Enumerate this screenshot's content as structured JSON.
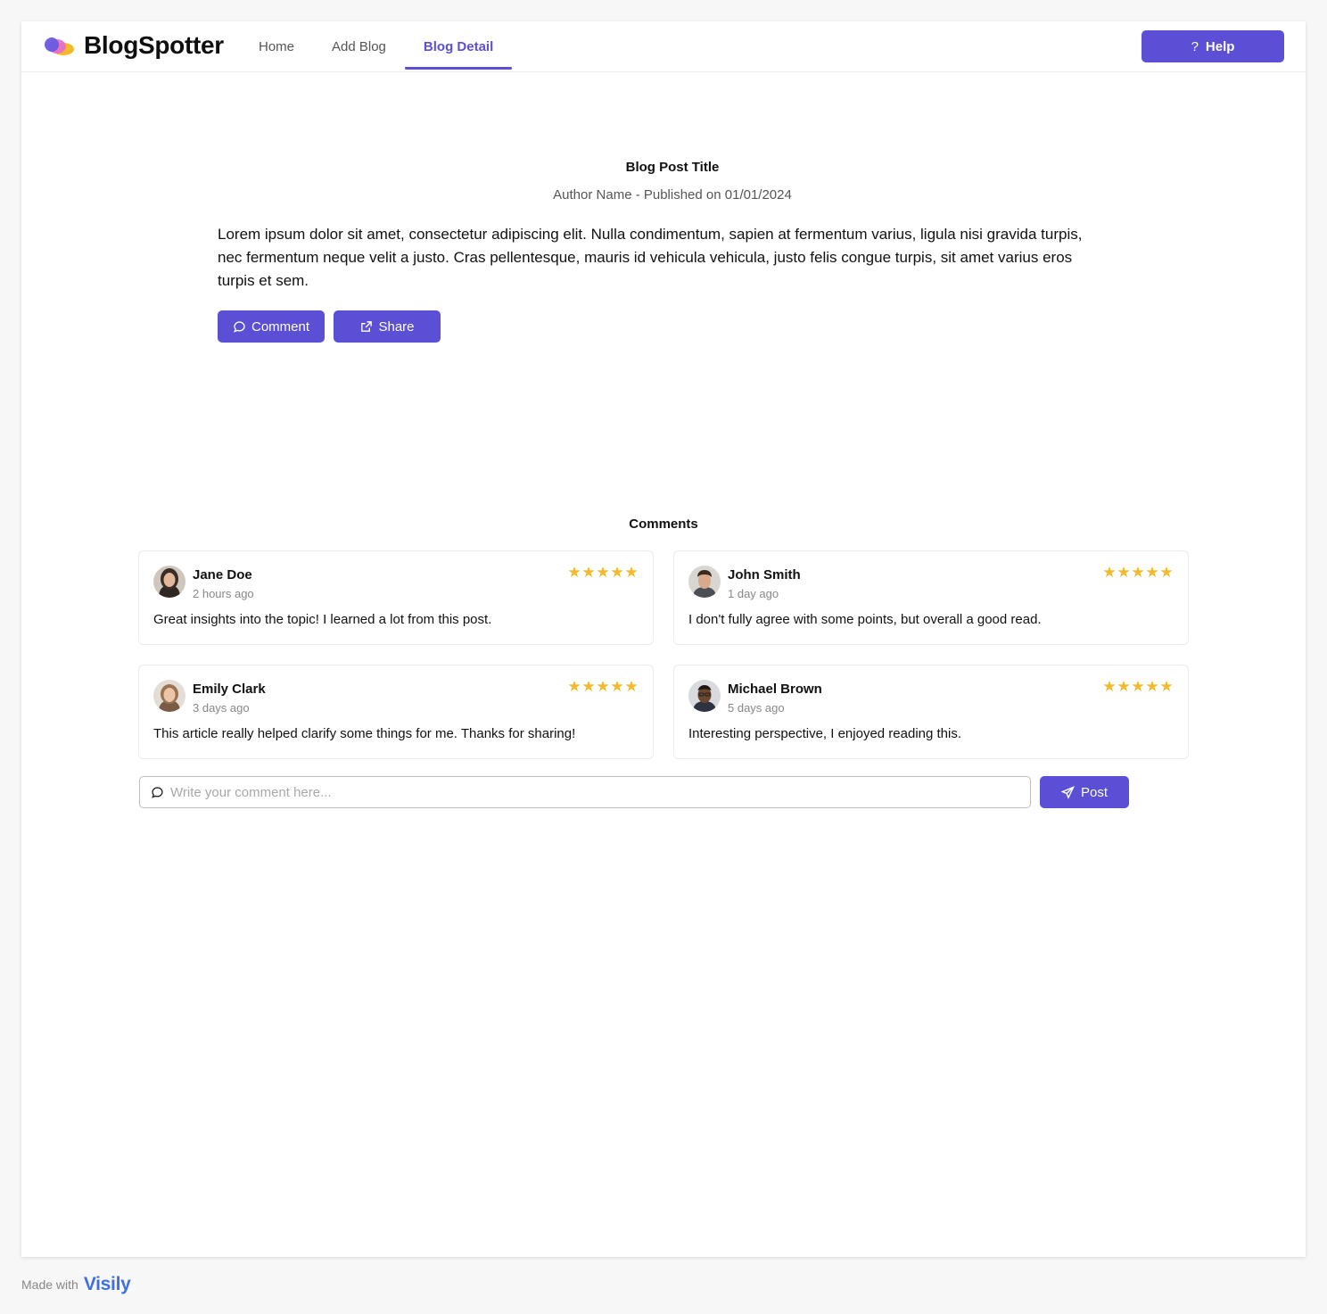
{
  "app": {
    "brand": "BlogSpotter",
    "accent_color": "#5b4fd6"
  },
  "nav": {
    "tabs": [
      {
        "label": "Home",
        "active": false
      },
      {
        "label": "Add Blog",
        "active": false
      },
      {
        "label": "Blog Detail",
        "active": true
      }
    ],
    "help_label": "Help",
    "help_icon": "question-icon"
  },
  "post": {
    "title": "Blog Post Title",
    "meta": "Author Name - Published on 01/01/2024",
    "body": "Lorem ipsum dolor sit amet, consectetur adipiscing elit. Nulla condimentum, sapien at fermentum varius, ligula nisi gravida turpis, nec fermentum neque velit a justo. Cras pellentesque, mauris id vehicula vehicula, justo felis congue turpis, sit amet varius eros turpis et sem.",
    "comment_label": "Comment",
    "share_label": "Share"
  },
  "comments": {
    "heading": "Comments",
    "items": [
      {
        "name": "Jane Doe",
        "time": "2 hours ago",
        "text": "Great insights into the topic! I learned a lot from this post.",
        "rating": 5
      },
      {
        "name": "John Smith",
        "time": "1 day ago",
        "text": "I don't fully agree with some points, but overall a good read.",
        "rating": 5
      },
      {
        "name": "Emily Clark",
        "time": "3 days ago",
        "text": "This article really helped clarify some things for me. Thanks for sharing!",
        "rating": 5
      },
      {
        "name": "Michael Brown",
        "time": "5 days ago",
        "text": "Interesting perspective, I enjoyed reading this.",
        "rating": 5
      }
    ],
    "star_color": "#f2b928"
  },
  "composer": {
    "placeholder": "Write your comment here...",
    "value": "",
    "post_label": "Post"
  },
  "footer": {
    "made_with": "Made with",
    "logo_text": "Visily"
  }
}
